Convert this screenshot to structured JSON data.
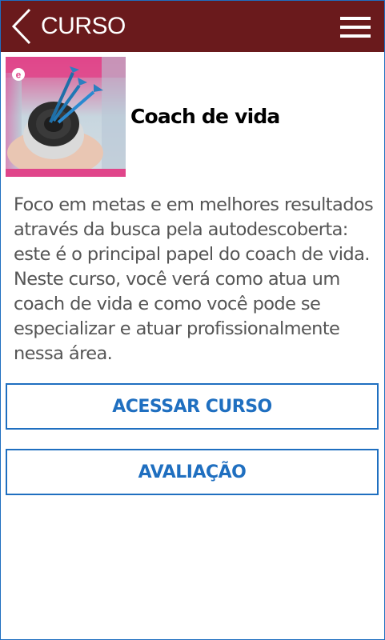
{
  "header": {
    "title": "CURSO",
    "background": "#6a1a1c",
    "back_icon": "chevron-left-icon",
    "menu_icon": "hamburger-menu-icon"
  },
  "course": {
    "title": "Coach de vida",
    "thumbnail_badge": "e",
    "description": "Foco em metas e em melhores resultados através da busca pela autodescoberta: este é o principal papel do coach de vida. Neste curso, você verá como atua um coach de vida e como você pode se especializar e atuar profissionalmente nessa área."
  },
  "actions": {
    "access_label": "ACESSAR CURSO",
    "evaluation_label": "AVALIAÇÃO",
    "accent": "#1f6fc0"
  }
}
